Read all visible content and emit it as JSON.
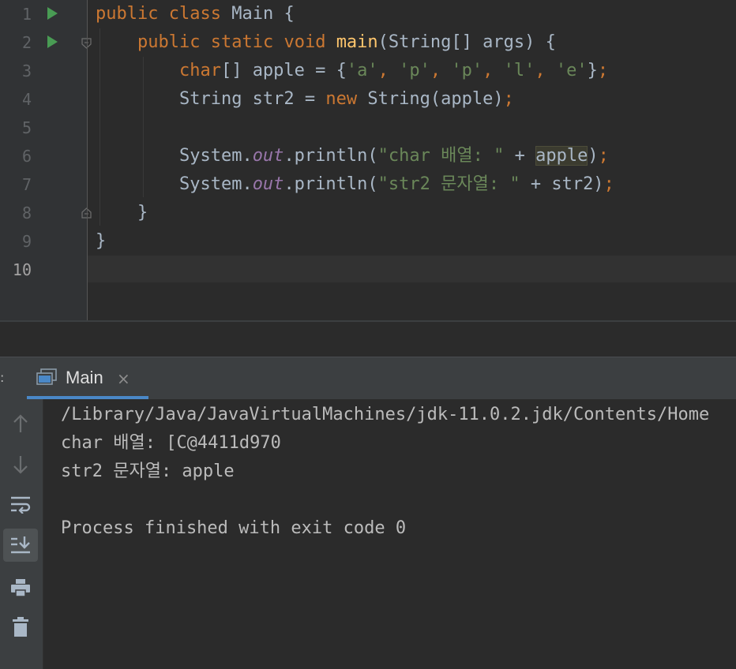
{
  "editor": {
    "line_numbers": [
      "1",
      "2",
      "3",
      "4",
      "5",
      "6",
      "7",
      "8",
      "9",
      "10"
    ],
    "code": {
      "l1": {
        "kw1": "public",
        "sp1": " ",
        "kw2": "class",
        "sp2": " ",
        "name": "Main",
        "rest": " {"
      },
      "l2": {
        "indent": "    ",
        "kw1": "public",
        "sp1": " ",
        "kw2": "static",
        "sp2": " ",
        "kw3": "void",
        "sp3": " ",
        "fn": "main",
        "rest": "(String[] args) {"
      },
      "l3": {
        "indent": "        ",
        "kw1": "char",
        "t1": "[] apple = {",
        "s1": "'a'",
        "c1": ", ",
        "s2": "'p'",
        "c2": ", ",
        "s3": "'p'",
        "c3": ", ",
        "s4": "'l'",
        "c4": ", ",
        "s5": "'e'",
        "t2": "}",
        "semi": ";"
      },
      "l4": {
        "indent": "        ",
        "t1": "String str2 = ",
        "kw1": "new",
        "t2": " String(apple)",
        "semi": ";"
      },
      "l6": {
        "indent": "        ",
        "t1": "System.",
        "fld": "out",
        "t2": ".println(",
        "str": "\"char 배열: \"",
        "t3": " + ",
        "hl": "apple",
        "t4": ")",
        "semi": ";"
      },
      "l7": {
        "indent": "        ",
        "t1": "System.",
        "fld": "out",
        "t2": ".println(",
        "str": "\"str2 문자열: \"",
        "t3": " + str2)",
        "semi": ";"
      },
      "l8": {
        "indent": "    ",
        "t1": "}"
      },
      "l9": {
        "t1": "}"
      }
    }
  },
  "run_panel": {
    "tab_label": "Main",
    "tab_close": "×",
    "tab_overflow": ":",
    "console_lines": [
      "/Library/Java/JavaVirtualMachines/jdk-11.0.2.jdk/Contents/Home",
      "char 배열: [C@4411d970",
      "str2 문자열: apple",
      "",
      "Process finished with exit code 0"
    ],
    "toolbar_icons": [
      "up-arrow-icon",
      "down-arrow-icon",
      "soft-wrap-icon",
      "scroll-to-end-icon",
      "print-icon",
      "trash-icon"
    ]
  },
  "colors": {
    "background": "#2b2b2b",
    "keyword": "#cc7832",
    "method": "#ffc66d",
    "string": "#6a8759",
    "field": "#9876aa",
    "text": "#a9b7c6",
    "run_arrow": "#499c54",
    "tab_underline": "#4a88c7"
  }
}
